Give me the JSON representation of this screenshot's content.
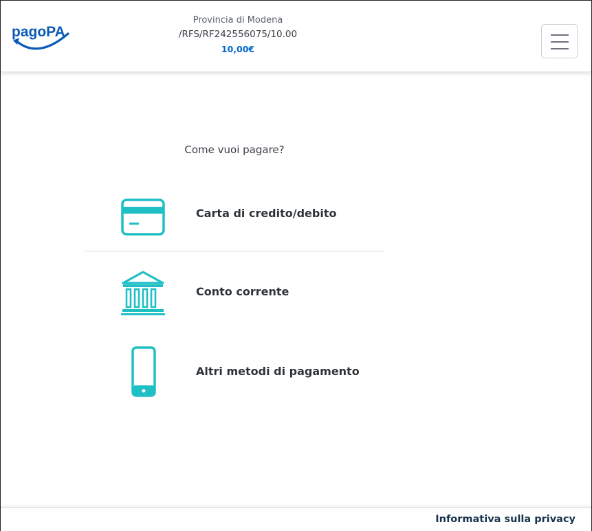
{
  "header": {
    "logo_text": "pagoPA",
    "creditor": "Provincia di Modena",
    "reference": "/RFS/RF242556075/10.00",
    "amount": "10,00€",
    "menu_icon": "hamburger-menu-icon"
  },
  "main": {
    "question": "Come vuoi pagare?",
    "options": [
      {
        "label": "Carta di credito/debito",
        "icon": "credit-card-icon"
      },
      {
        "label": "Conto corrente",
        "icon": "bank-icon"
      },
      {
        "label": "Altri metodi di pagamento",
        "icon": "smartphone-icon"
      }
    ]
  },
  "footer": {
    "privacy_link": "Informativa sulla privacy"
  },
  "colors": {
    "accent_teal": "#1ebfc5",
    "brand_blue": "#0066cc",
    "logo_blue": "#0a5bb8",
    "text_dark": "#2e3338"
  }
}
